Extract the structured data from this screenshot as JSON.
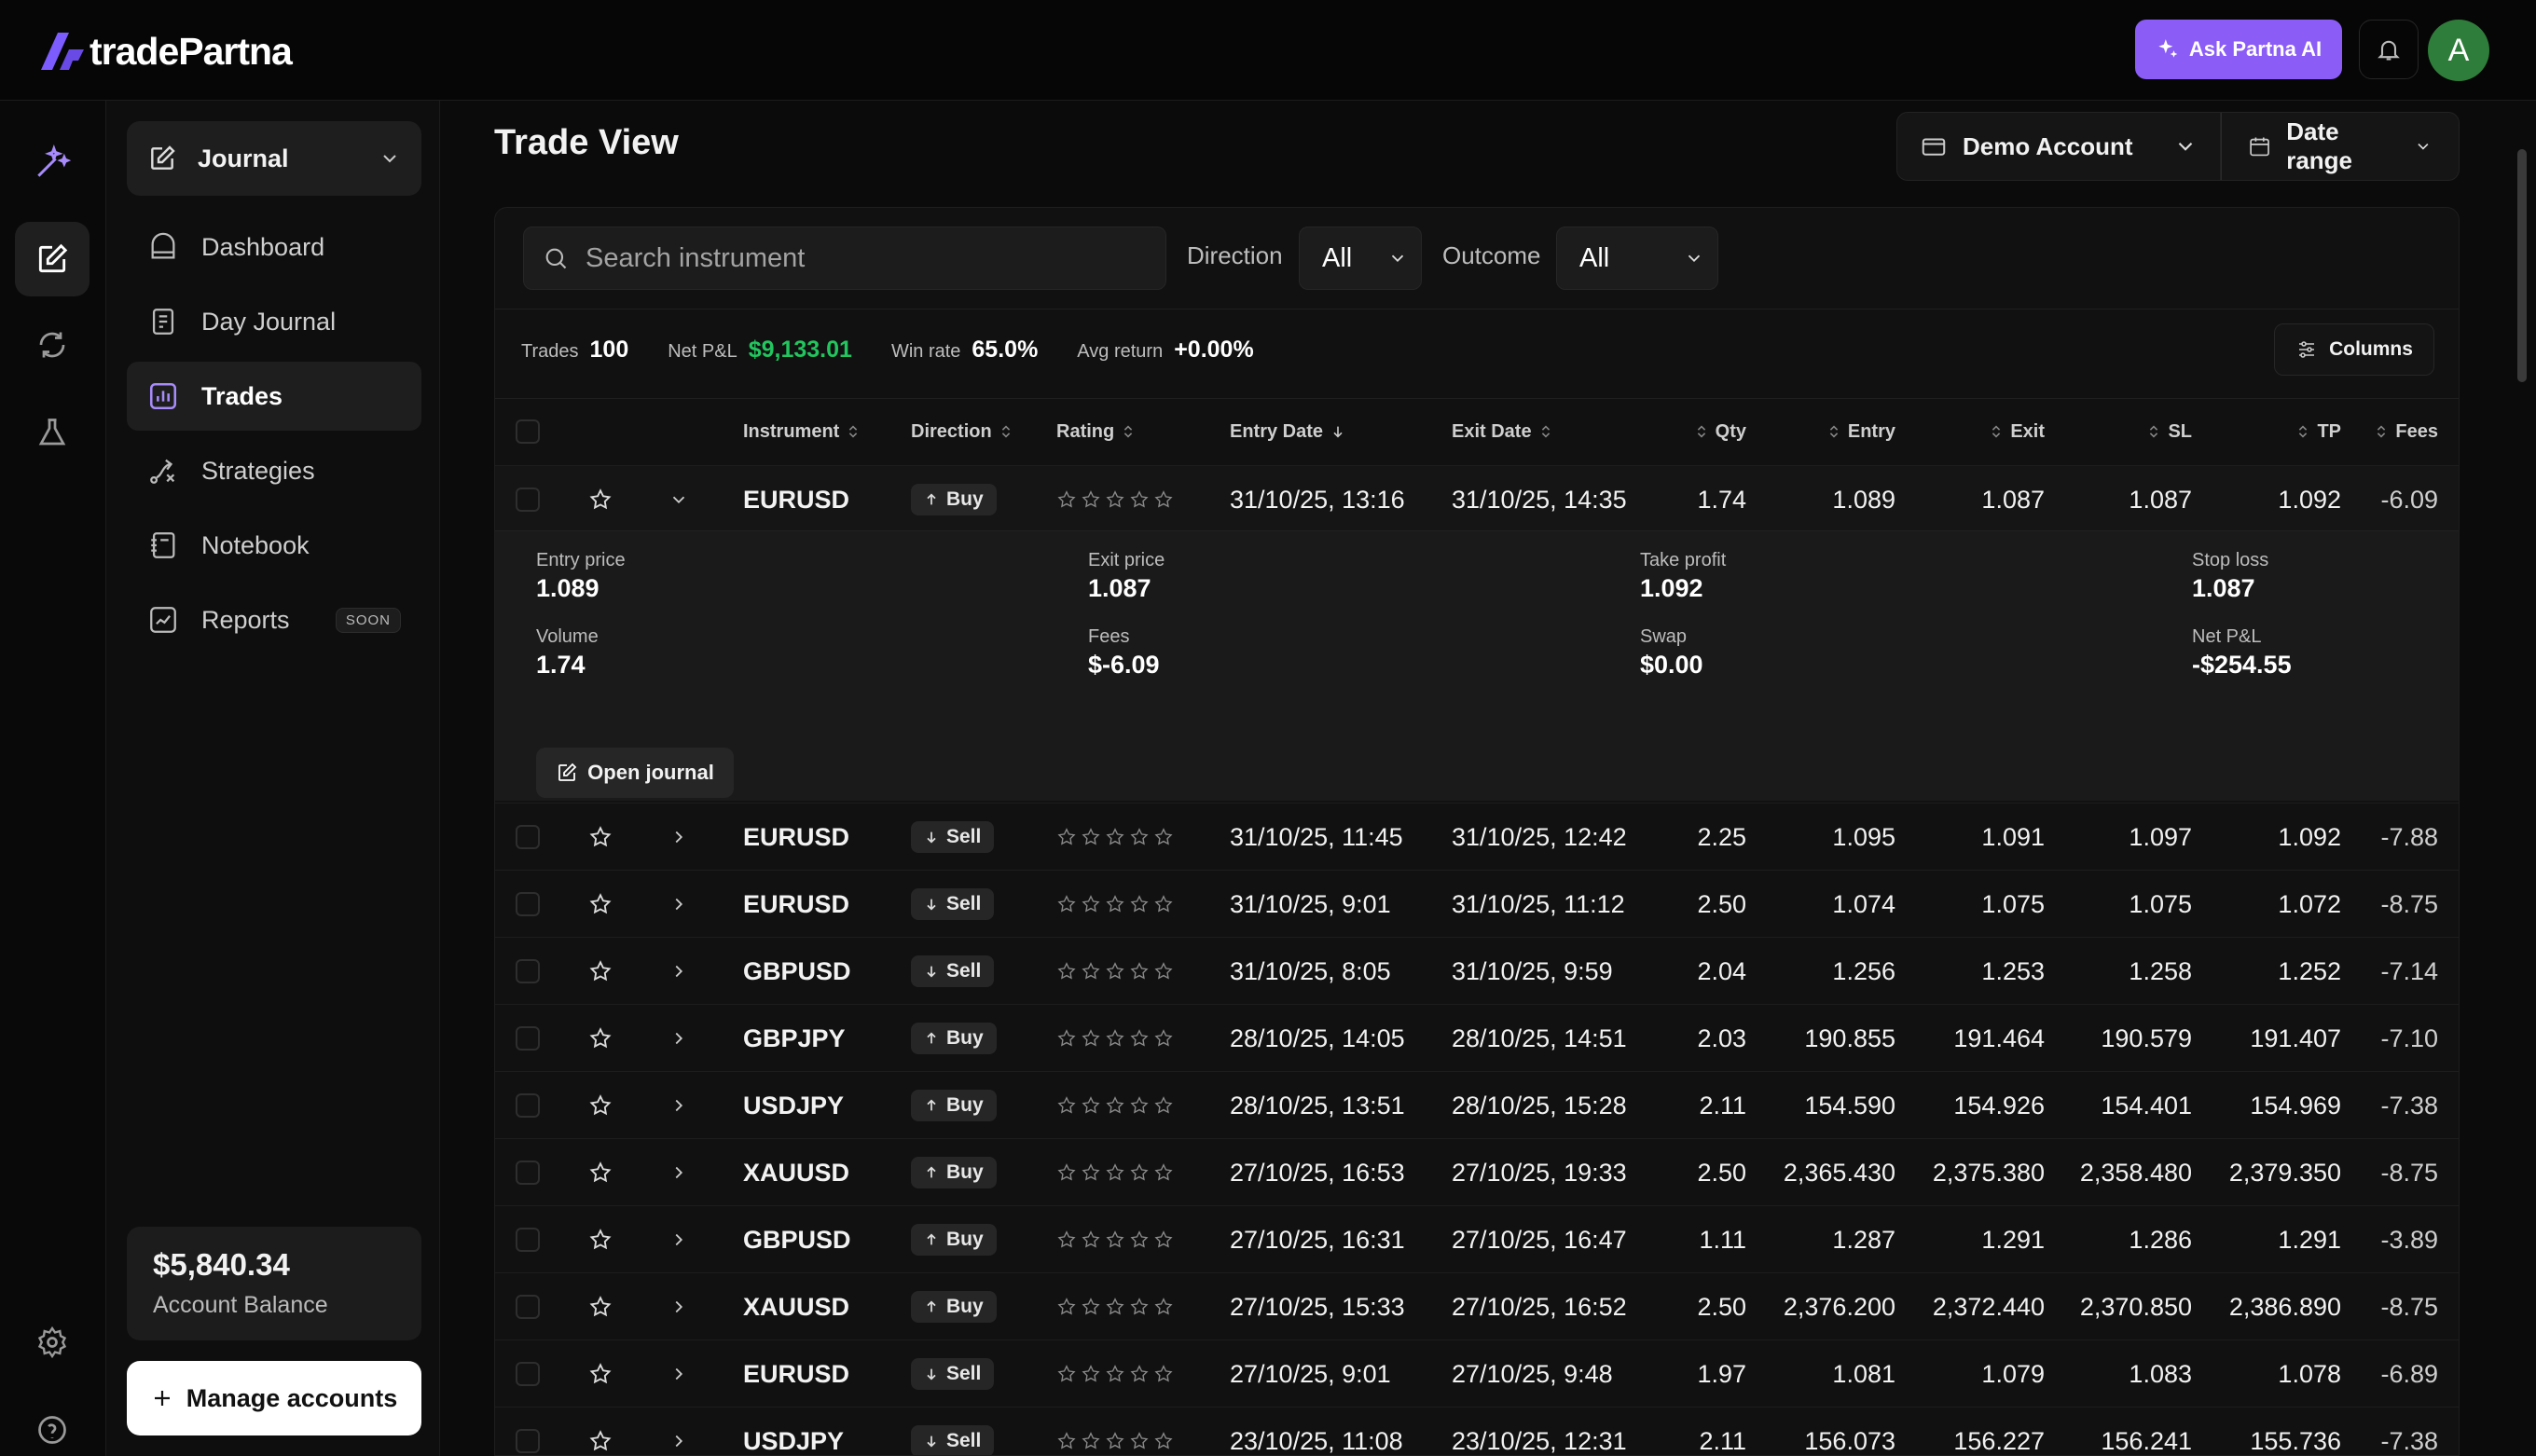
{
  "app": {
    "name": "tradePartna"
  },
  "topbar": {
    "ask_label": "Ask Partna AI",
    "avatar_initial": "A"
  },
  "sidebar": {
    "section": "Journal",
    "items": [
      {
        "label": "Dashboard",
        "icon": "dashboard-icon"
      },
      {
        "label": "Day Journal",
        "icon": "day-journal-icon"
      },
      {
        "label": "Trades",
        "icon": "trades-icon",
        "active": true
      },
      {
        "label": "Strategies",
        "icon": "strategies-icon"
      },
      {
        "label": "Notebook",
        "icon": "notebook-icon"
      },
      {
        "label": "Reports",
        "icon": "reports-icon",
        "badge": "SOON"
      }
    ],
    "balance": {
      "amount": "$5,840.34",
      "label": "Account Balance"
    },
    "manage_label": "Manage accounts"
  },
  "header": {
    "title": "Trade View",
    "account": "Demo Account",
    "date_range": "Date range"
  },
  "filters": {
    "search_placeholder": "Search instrument",
    "direction_label": "Direction",
    "direction_value": "All",
    "outcome_label": "Outcome",
    "outcome_value": "All"
  },
  "stats": {
    "trades_label": "Trades",
    "trades": "100",
    "netpl_label": "Net P&L",
    "netpl": "$9,133.01",
    "winrate_label": "Win rate",
    "winrate": "65.0%",
    "avgret_label": "Avg return",
    "avgret": "+0.00%",
    "columns_label": "Columns"
  },
  "columns": [
    "Instrument",
    "Direction",
    "Rating",
    "Entry Date",
    "Exit Date",
    "Qty",
    "Entry",
    "Exit",
    "SL",
    "TP",
    "Fees"
  ],
  "expanded": {
    "entry_price_label": "Entry price",
    "entry_price": "1.089",
    "exit_price_label": "Exit price",
    "exit_price": "1.087",
    "take_profit_label": "Take profit",
    "take_profit": "1.092",
    "stop_loss_label": "Stop loss",
    "stop_loss": "1.087",
    "volume_label": "Volume",
    "volume": "1.74",
    "fees_label": "Fees",
    "fees": "$-6.09",
    "swap_label": "Swap",
    "swap": "$0.00",
    "netpl_label": "Net P&L",
    "netpl": "-$254.55",
    "open_label": "Open journal"
  },
  "trades": [
    {
      "instrument": "EURUSD",
      "direction": "Buy",
      "entry_date": "31/10/25, 13:16",
      "exit_date": "31/10/25, 14:35",
      "qty": "1.74",
      "entry": "1.089",
      "exit": "1.087",
      "sl": "1.087",
      "tp": "1.092",
      "fees": "-6.09"
    },
    {
      "instrument": "EURUSD",
      "direction": "Sell",
      "entry_date": "31/10/25, 11:45",
      "exit_date": "31/10/25, 12:42",
      "qty": "2.25",
      "entry": "1.095",
      "exit": "1.091",
      "sl": "1.097",
      "tp": "1.092",
      "fees": "-7.88"
    },
    {
      "instrument": "EURUSD",
      "direction": "Sell",
      "entry_date": "31/10/25, 9:01",
      "exit_date": "31/10/25, 11:12",
      "qty": "2.50",
      "entry": "1.074",
      "exit": "1.075",
      "sl": "1.075",
      "tp": "1.072",
      "fees": "-8.75"
    },
    {
      "instrument": "GBPUSD",
      "direction": "Sell",
      "entry_date": "31/10/25, 8:05",
      "exit_date": "31/10/25, 9:59",
      "qty": "2.04",
      "entry": "1.256",
      "exit": "1.253",
      "sl": "1.258",
      "tp": "1.252",
      "fees": "-7.14"
    },
    {
      "instrument": "GBPJPY",
      "direction": "Buy",
      "entry_date": "28/10/25, 14:05",
      "exit_date": "28/10/25, 14:51",
      "qty": "2.03",
      "entry": "190.855",
      "exit": "191.464",
      "sl": "190.579",
      "tp": "191.407",
      "fees": "-7.10"
    },
    {
      "instrument": "USDJPY",
      "direction": "Buy",
      "entry_date": "28/10/25, 13:51",
      "exit_date": "28/10/25, 15:28",
      "qty": "2.11",
      "entry": "154.590",
      "exit": "154.926",
      "sl": "154.401",
      "tp": "154.969",
      "fees": "-7.38"
    },
    {
      "instrument": "XAUUSD",
      "direction": "Buy",
      "entry_date": "27/10/25, 16:53",
      "exit_date": "27/10/25, 19:33",
      "qty": "2.50",
      "entry": "2,365.430",
      "exit": "2,375.380",
      "sl": "2,358.480",
      "tp": "2,379.350",
      "fees": "-8.75"
    },
    {
      "instrument": "GBPUSD",
      "direction": "Buy",
      "entry_date": "27/10/25, 16:31",
      "exit_date": "27/10/25, 16:47",
      "qty": "1.11",
      "entry": "1.287",
      "exit": "1.291",
      "sl": "1.286",
      "tp": "1.291",
      "fees": "-3.89"
    },
    {
      "instrument": "XAUUSD",
      "direction": "Buy",
      "entry_date": "27/10/25, 15:33",
      "exit_date": "27/10/25, 16:52",
      "qty": "2.50",
      "entry": "2,376.200",
      "exit": "2,372.440",
      "sl": "2,370.850",
      "tp": "2,386.890",
      "fees": "-8.75"
    },
    {
      "instrument": "EURUSD",
      "direction": "Sell",
      "entry_date": "27/10/25, 9:01",
      "exit_date": "27/10/25, 9:48",
      "qty": "1.97",
      "entry": "1.081",
      "exit": "1.079",
      "sl": "1.083",
      "tp": "1.078",
      "fees": "-6.89"
    },
    {
      "instrument": "USDJPY",
      "direction": "Sell",
      "entry_date": "23/10/25, 11:08",
      "exit_date": "23/10/25, 12:31",
      "qty": "2.11",
      "entry": "156.073",
      "exit": "156.227",
      "sl": "156.241",
      "tp": "155.736",
      "fees": "-7.38"
    }
  ],
  "colors": {
    "accent": "#8b5cf6",
    "positive": "#22c55e",
    "logo": "#7c5cff"
  }
}
